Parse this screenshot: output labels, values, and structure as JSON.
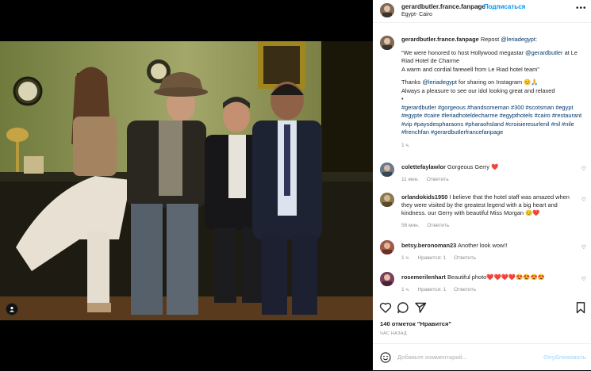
{
  "post": {
    "username": "gerardbutler.france.fanpage",
    "follow_label": "Подписаться",
    "location": "Egypt- Cairo",
    "caption_user": "gerardbutler.france.fanpage",
    "caption_intro": "Repost",
    "caption_mention": "@leriadegypt",
    "caption_colon": ":",
    "quote_a": "\"We were honored to host Hollywood megastar",
    "quote_mention": "@gerardbutler",
    "quote_b": "at Le Riad Hotel de Charme",
    "quote_line2": "A warm and cordial farewell from Le Riad hotel team\"",
    "thanks_a": "Thanks",
    "thanks_mention": "@leriadegypt",
    "thanks_b": "for sharing on Instagram 😊🙏",
    "line_always": "Always a pleasure to see our idol looking great and relaxed",
    "bullet": "•",
    "hashtags": "#gerardbutler #gorgeous #handsomeman #300 #scotsman #egypt #egypte #caire #leriadhoteldecharme #egypthotels #cairo #restaurant #vip #paysdespharaons #pharaohsland #croisieresurlenil #nil #nile #frenchfan #gerardbutlerfrancefanpage",
    "caption_time": "1 ч."
  },
  "comments": [
    {
      "user": "colettefaylawlor",
      "text": "Gorgeous Gerry ❤️",
      "time": "11 мин.",
      "likes": "",
      "reply": "Ответить"
    },
    {
      "user": "orlandokids1950",
      "text": "I believe that the hotel staff was amazed when they were visited by the greatest legend with a big heart and kindness. our Gerry with beautiful Miss Morgan 😊❤️",
      "time": "56 мин.",
      "likes": "",
      "reply": "Ответить"
    },
    {
      "user": "betsy.beronoman23",
      "text": "Another look wow!!",
      "time": "1 ч.",
      "likes": "Нравится: 1",
      "reply": "Ответить"
    },
    {
      "user": "rosemerilenhart",
      "text": "Beautiful photo❤️❤️❤️❤️😍😍😍😍",
      "time": "1 ч.",
      "likes": "Нравится: 1",
      "reply": "Ответить"
    }
  ],
  "footer": {
    "likes": "140 отметок \"Нравится\"",
    "time": "ЧАС НАЗАД",
    "comment_placeholder": "Добавьте комментарий...",
    "publish_label": "Опубликовать"
  },
  "icons": {
    "heart": "heart-icon",
    "comment": "comment-icon",
    "share": "share-icon",
    "save": "bookmark-icon",
    "emoji": "emoji-icon",
    "more": "more-options-icon",
    "tag": "user-tag-icon"
  },
  "colors": {
    "accent": "#0095f6",
    "link": "#00376b",
    "muted": "#8e8e8e"
  }
}
